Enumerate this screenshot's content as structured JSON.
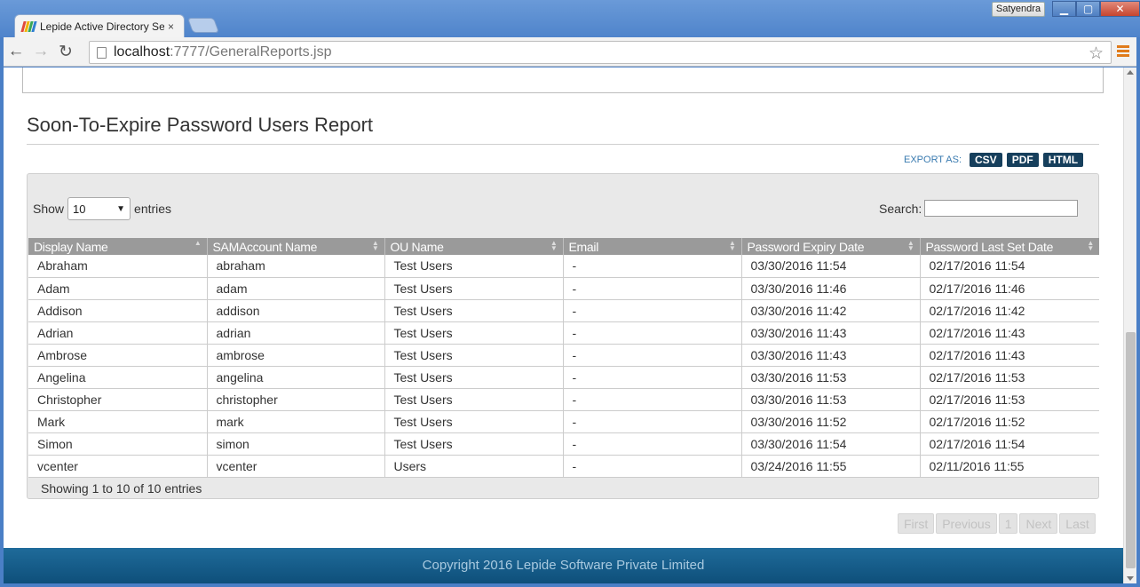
{
  "browser": {
    "tab_title": "Lepide Active Directory Self Se",
    "tab_close": "×",
    "user": "Satyendra",
    "window_buttons": {
      "minimize": "▁",
      "maximize": "▢",
      "close": "✕"
    },
    "nav": {
      "back": "←",
      "forward": "→",
      "reload": "↻",
      "star": "☆"
    },
    "url_host": "localhost",
    "url_path": ":7777/GeneralReports.jsp"
  },
  "report": {
    "title": "Soon-To-Expire Password Users Report",
    "export_label": "EXPORT AS:",
    "export_buttons": [
      "CSV",
      "PDF",
      "HTML"
    ],
    "length_prefix": "Show",
    "length_value": "10",
    "length_suffix": "entries",
    "search_label": "Search:",
    "search_value": "",
    "columns": [
      "Display Name",
      "SAMAccount Name",
      "OU Name",
      "Email",
      "Password Expiry Date",
      "Password Last Set Date"
    ],
    "rows": [
      [
        "Abraham",
        "abraham",
        "Test Users",
        "-",
        "03/30/2016 11:54",
        "02/17/2016 11:54"
      ],
      [
        "Adam",
        "adam",
        "Test Users",
        "-",
        "03/30/2016 11:46",
        "02/17/2016 11:46"
      ],
      [
        "Addison",
        "addison",
        "Test Users",
        "-",
        "03/30/2016 11:42",
        "02/17/2016 11:42"
      ],
      [
        "Adrian",
        "adrian",
        "Test Users",
        "-",
        "03/30/2016 11:43",
        "02/17/2016 11:43"
      ],
      [
        "Ambrose",
        "ambrose",
        "Test Users",
        "-",
        "03/30/2016 11:43",
        "02/17/2016 11:43"
      ],
      [
        "Angelina",
        "angelina",
        "Test Users",
        "-",
        "03/30/2016 11:53",
        "02/17/2016 11:53"
      ],
      [
        "Christopher",
        "christopher",
        "Test Users",
        "-",
        "03/30/2016 11:53",
        "02/17/2016 11:53"
      ],
      [
        "Mark",
        "mark",
        "Test Users",
        "-",
        "03/30/2016 11:52",
        "02/17/2016 11:52"
      ],
      [
        "Simon",
        "simon",
        "Test Users",
        "-",
        "03/30/2016 11:54",
        "02/17/2016 11:54"
      ],
      [
        "vcenter",
        "vcenter",
        "Users",
        "-",
        "03/24/2016 11:55",
        "02/11/2016 11:55"
      ]
    ],
    "info": "Showing 1 to 10 of 10 entries",
    "pager": [
      "First",
      "Previous",
      "1",
      "Next",
      "Last"
    ]
  },
  "footer": {
    "copyright": "Copyright 2016 Lepide Software Private Limited"
  },
  "colors": {
    "header_bg": "#9a9a9a",
    "export_btn": "#163f5c",
    "footer_bg": "#0e4f7a",
    "link": "#3a7bb0"
  },
  "icons": [
    "favicon-icon",
    "close-icon",
    "back-icon",
    "forward-icon",
    "reload-icon",
    "page-icon",
    "star-icon",
    "menu-icon",
    "sort-icon",
    "dropdown-caret-icon"
  ]
}
